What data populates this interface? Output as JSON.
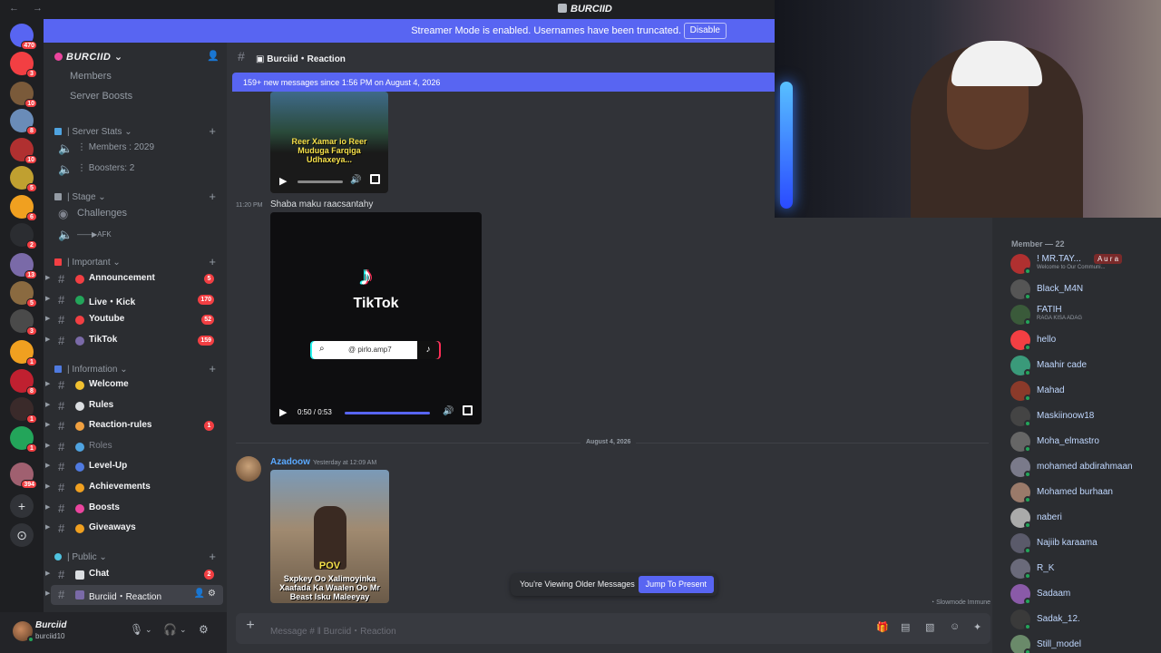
{
  "window": {
    "title": "BURCIID",
    "nav": "← →"
  },
  "banner": {
    "message": "Streamer Mode is enabled. Usernames have been truncated.",
    "disable_label": "Disable"
  },
  "rail": {
    "servers": [
      {
        "badge": "470",
        "color": "#5865f2"
      },
      {
        "badge": "3",
        "color": "#f23f43"
      },
      {
        "badge": "10",
        "color": "#7a5a3a"
      },
      {
        "badge": "8",
        "color": "#6a8cb8"
      },
      {
        "badge": "10",
        "color": "#b03030"
      },
      {
        "badge": "5",
        "color": "#c0a030"
      },
      {
        "badge": "6",
        "color": "#f0a020"
      },
      {
        "badge": "2",
        "color": "#2b2d31"
      },
      {
        "badge": "13",
        "color": "#7a6aa8"
      },
      {
        "badge": "5",
        "color": "#8a6a40"
      },
      {
        "badge": "3",
        "color": "#4a4a4a"
      },
      {
        "badge": "1",
        "color": "#f0a020"
      },
      {
        "badge": "8",
        "color": "#c02030"
      },
      {
        "badge": "1",
        "color": "#3a2a2a"
      },
      {
        "badge": "1",
        "color": "#23a55a"
      },
      {
        "badge": "394",
        "color": "#a06070"
      }
    ]
  },
  "sidebar": {
    "server_name": "BURCIID",
    "items": [
      {
        "kind": "plain",
        "label": "Members"
      },
      {
        "kind": "plain",
        "label": "Server Boosts"
      }
    ],
    "categories": {
      "server_stats": "Server Stats",
      "stage": "Stage",
      "important": "Important",
      "information": "Information",
      "public": "Public"
    },
    "stats": {
      "members": "⋮ Members : 2029",
      "boosters": "⋮ Boosters: 2"
    },
    "stage": {
      "challenges": "Challenges",
      "afk": "——▶AFK"
    },
    "important": [
      {
        "label": "Announcement",
        "badge": "5"
      },
      {
        "label": "Live・Kick",
        "badge": "170"
      },
      {
        "label": "Youtube",
        "badge": "52"
      },
      {
        "label": "TikTok",
        "badge": "159"
      }
    ],
    "information": [
      {
        "label": "Welcome",
        "badge": ""
      },
      {
        "label": "Rules",
        "badge": ""
      },
      {
        "label": "Reaction-rules",
        "badge": "1"
      },
      {
        "label": "Roles",
        "badge": ""
      },
      {
        "label": "Level-Up",
        "badge": ""
      },
      {
        "label": "Achievements",
        "badge": ""
      },
      {
        "label": "Boosts",
        "badge": ""
      },
      {
        "label": "Giveaways",
        "badge": ""
      }
    ],
    "public": [
      {
        "label": "Chat",
        "badge": "2"
      },
      {
        "label": "Burciid・Reaction",
        "badge": ""
      }
    ]
  },
  "user": {
    "name": "Burciid",
    "tag": "burciid10"
  },
  "chat": {
    "channel": "Burciid・Reaction",
    "new_messages": "159+ new messages since 1:56 PM on August 4, 2026",
    "video1_caption": "Reer Xamar io Reer Muduga Farqiga Udhaxeya...",
    "msg2_time": "11:20 PM",
    "msg2_text": "Shaba maku raacsantahy",
    "tiktok_brand": "TikTok",
    "tiktok_user": "@ pirlo.amp7",
    "video2_time": "0:50 / 0:53",
    "video2_progress": 0.94,
    "date_divider": "August 4, 2026",
    "msg3_author": "Azadoow",
    "msg3_time": "Yesterday at 12:09 AM",
    "video3_caption": "Sxpkey Oo Xalimoyinka Xaafada Ka Waalen Oo Mr Beast Isku Maleeyay",
    "video3_pov": "POV",
    "older_label": "You're Viewing Older Messages",
    "jump_label": "Jump To Present",
    "composer_placeholder": "Message # ‖ Burciid・Reaction",
    "slowmode": "Slowmode Immune"
  },
  "members": {
    "header": "Member — 22",
    "list": [
      {
        "name": "! MR.TAY...",
        "sub": "Welcome to Our Communi...",
        "color": "#b03030",
        "extra": "A u r a"
      },
      {
        "name": "Black_M4N",
        "sub": "",
        "color": "#555"
      },
      {
        "name": "FATIH",
        "sub": "RAGA KISA ADAG",
        "color": "#3a5a3a"
      },
      {
        "name": "hello",
        "sub": "",
        "color": "#f23f43"
      },
      {
        "name": "Maahir cade",
        "sub": "",
        "color": "#3a9a7a"
      },
      {
        "name": "Mahad",
        "sub": "",
        "color": "#8a3a2a"
      },
      {
        "name": "Maskiinoow18",
        "sub": "",
        "color": "#444"
      },
      {
        "name": "Moha_elmastro",
        "sub": "",
        "color": "#666"
      },
      {
        "name": "mohamed abdirahmaan",
        "sub": "",
        "color": "#7a7a8a"
      },
      {
        "name": "Mohamed burhaan",
        "sub": "",
        "color": "#9a7a6a"
      },
      {
        "name": "naberi",
        "sub": "",
        "color": "#aaa"
      },
      {
        "name": "Najiib karaama",
        "sub": "",
        "color": "#5a5a6a"
      },
      {
        "name": "R_K",
        "sub": "",
        "color": "#6a6a7a"
      },
      {
        "name": "Sadaam",
        "sub": "",
        "color": "#8a5aa8"
      },
      {
        "name": "Sadak_12.",
        "sub": "",
        "color": "#3a3a3a"
      },
      {
        "name": "Still_model",
        "sub": "",
        "color": "#6a8a6a"
      }
    ]
  },
  "colors": {
    "accent": "#5865f2",
    "danger": "#f23f43",
    "online": "#23a55a"
  }
}
